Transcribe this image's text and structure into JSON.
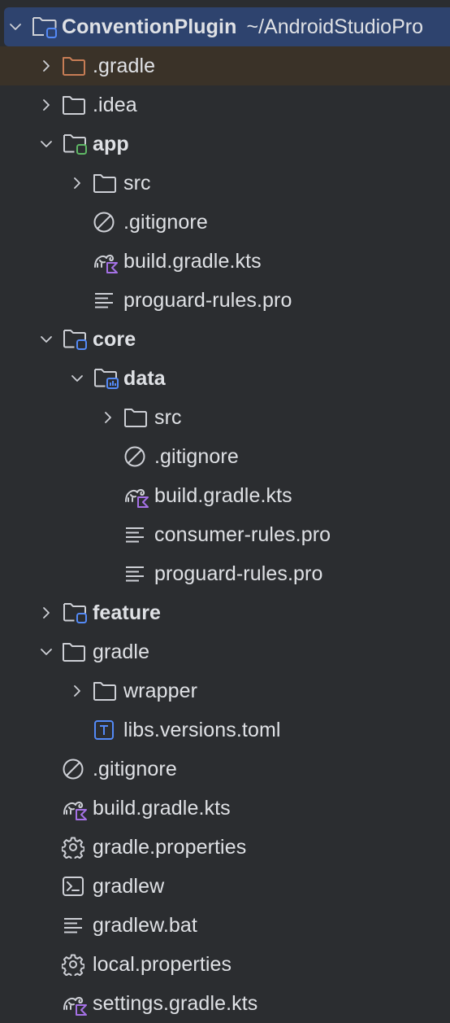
{
  "project_tree": {
    "root": {
      "label": "ConventionPlugin",
      "path": "~/AndroidStudioPro"
    },
    "items": [
      {
        "label": ".gradle",
        "depth": 1,
        "expander": "collapsed",
        "icon": "folder-excluded-icon",
        "bold": false,
        "highlight": true
      },
      {
        "label": ".idea",
        "depth": 1,
        "expander": "collapsed",
        "icon": "folder-icon",
        "bold": false
      },
      {
        "label": "app",
        "depth": 1,
        "expander": "expanded",
        "icon": "module-folder-green-icon",
        "bold": true
      },
      {
        "label": "src",
        "depth": 2,
        "expander": "collapsed",
        "icon": "folder-icon",
        "bold": false
      },
      {
        "label": ".gitignore",
        "depth": 2,
        "expander": "none",
        "icon": "gitignore-icon",
        "bold": false
      },
      {
        "label": "build.gradle.kts",
        "depth": 2,
        "expander": "none",
        "icon": "gradle-kotlin-icon",
        "bold": false
      },
      {
        "label": "proguard-rules.pro",
        "depth": 2,
        "expander": "none",
        "icon": "text-file-icon",
        "bold": false
      },
      {
        "label": "core",
        "depth": 1,
        "expander": "expanded",
        "icon": "module-folder-icon",
        "bold": true
      },
      {
        "label": "data",
        "depth": 2,
        "expander": "expanded",
        "icon": "library-module-folder-icon",
        "bold": true
      },
      {
        "label": "src",
        "depth": 3,
        "expander": "collapsed",
        "icon": "folder-icon",
        "bold": false
      },
      {
        "label": ".gitignore",
        "depth": 3,
        "expander": "none",
        "icon": "gitignore-icon",
        "bold": false
      },
      {
        "label": "build.gradle.kts",
        "depth": 3,
        "expander": "none",
        "icon": "gradle-kotlin-icon",
        "bold": false
      },
      {
        "label": "consumer-rules.pro",
        "depth": 3,
        "expander": "none",
        "icon": "text-file-icon",
        "bold": false
      },
      {
        "label": "proguard-rules.pro",
        "depth": 3,
        "expander": "none",
        "icon": "text-file-icon",
        "bold": false
      },
      {
        "label": "feature",
        "depth": 1,
        "expander": "collapsed",
        "icon": "module-folder-icon",
        "bold": true
      },
      {
        "label": "gradle",
        "depth": 1,
        "expander": "expanded",
        "icon": "folder-icon",
        "bold": false
      },
      {
        "label": "wrapper",
        "depth": 2,
        "expander": "collapsed",
        "icon": "folder-icon",
        "bold": false
      },
      {
        "label": "libs.versions.toml",
        "depth": 2,
        "expander": "none",
        "icon": "toml-file-icon",
        "bold": false
      },
      {
        "label": ".gitignore",
        "depth": 1,
        "expander": "none",
        "icon": "gitignore-icon",
        "bold": false
      },
      {
        "label": "build.gradle.kts",
        "depth": 1,
        "expander": "none",
        "icon": "gradle-kotlin-icon",
        "bold": false
      },
      {
        "label": "gradle.properties",
        "depth": 1,
        "expander": "none",
        "icon": "gear-icon",
        "bold": false
      },
      {
        "label": "gradlew",
        "depth": 1,
        "expander": "none",
        "icon": "terminal-icon",
        "bold": false
      },
      {
        "label": "gradlew.bat",
        "depth": 1,
        "expander": "none",
        "icon": "text-file-icon",
        "bold": false
      },
      {
        "label": "local.properties",
        "depth": 1,
        "expander": "none",
        "icon": "gear-icon",
        "bold": false
      },
      {
        "label": "settings.gradle.kts",
        "depth": 1,
        "expander": "none",
        "icon": "gradle-kotlin-icon",
        "bold": false
      }
    ]
  },
  "colors": {
    "background": "#2b2d30",
    "selection": "#2e436e",
    "excluded_highlight": "#3a3228",
    "text": "#dfe1e5",
    "icon_stroke": "#ced0d6",
    "excluded_folder": "#c77d55",
    "module_badge_blue": "#548af7",
    "module_badge_green": "#5fb865",
    "kotlin_purple": "#a571e6"
  }
}
